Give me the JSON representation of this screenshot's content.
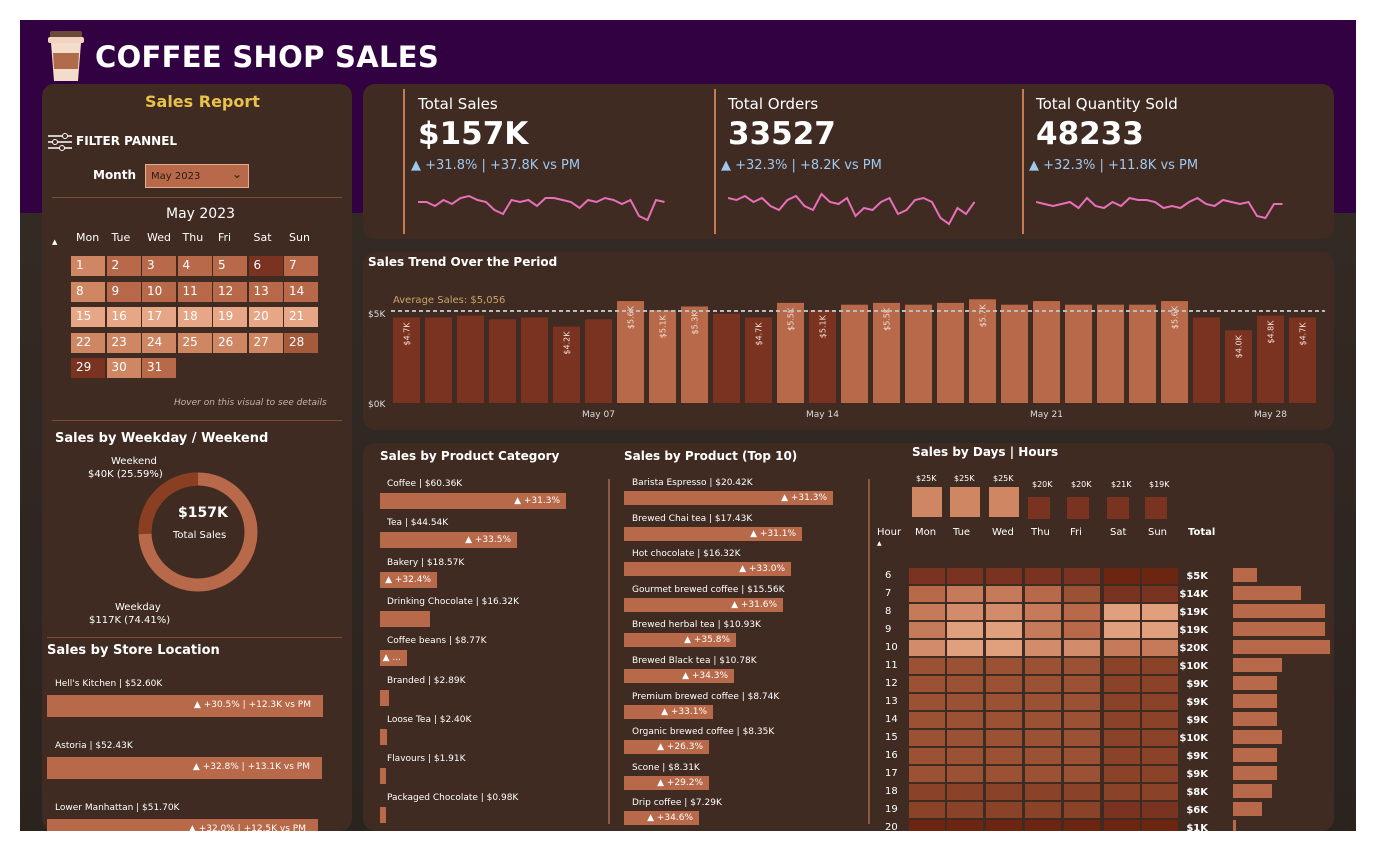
{
  "header": {
    "title": "COFFEE SHOP SALES"
  },
  "sidebar": {
    "title": "Sales Report",
    "filter_label": "FILTER PANNEL",
    "month_label": "Month",
    "month_value": "May 2023",
    "calendar": {
      "title": "May 2023",
      "weekdays": [
        "Mon",
        "Tue",
        "Wed",
        "Thu",
        "Fri",
        "Sat",
        "Sun"
      ],
      "days": [
        "1",
        "2",
        "3",
        "4",
        "5",
        "6",
        "7",
        "8",
        "9",
        "10",
        "11",
        "12",
        "13",
        "14",
        "15",
        "16",
        "17",
        "18",
        "19",
        "20",
        "21",
        "22",
        "23",
        "24",
        "25",
        "26",
        "27",
        "28",
        "29",
        "30",
        "31"
      ],
      "hint": "Hover on this visual to see details"
    },
    "weekday_section": {
      "title": "Sales by Weekday / Weekend",
      "weekend_label": "Weekend",
      "weekend_value": "$40K (25.59%)",
      "weekday_label": "Weekday",
      "weekday_value": "$117K (74.41%)",
      "center_value": "$157K",
      "center_label": "Total Sales",
      "weekend_share": 0.2559
    },
    "store_section": {
      "title": "Sales by Store Location",
      "stores": [
        {
          "label": "Hell's Kitchen | $52.60K",
          "change": "▲ +30.5% | +12.3K vs PM",
          "share": 1.0
        },
        {
          "label": "Astoria | $52.43K",
          "change": "▲ +32.8% | +13.1K vs PM",
          "share": 0.997
        },
        {
          "label": "Lower Manhattan | $51.70K",
          "change": "▲ +32.0% | +12.5K vs PM",
          "share": 0.983
        }
      ]
    }
  },
  "kpis": [
    {
      "title": "Total Sales",
      "value": "$157K",
      "change": "▲ +31.8% | +37.8K vs PM"
    },
    {
      "title": "Total Orders",
      "value": "33527",
      "change": "▲ +32.3% | +8.2K vs PM"
    },
    {
      "title": "Total Quantity Sold",
      "value": "48233",
      "change": "▲ +32.3% | +11.8K vs PM"
    }
  ],
  "trend": {
    "title": "Sales Trend Over the Period",
    "avg_label": "Average Sales: $5,056",
    "y_ticks": [
      "$5K",
      "$0K"
    ],
    "x_ticks": [
      "May 07",
      "May 14",
      "May 21",
      "May 28"
    ],
    "bar_labels": [
      "$4.7K",
      "$4.2K",
      "$5.6K",
      "$5.1K",
      "$5.3K",
      "$4.7K",
      "$5.5K",
      "$5.1K",
      "$5.5K",
      "$5.7K",
      "$5.6K",
      "$4.0K",
      "$4.8K",
      "$4.7K"
    ]
  },
  "chart_data": {
    "type": "bar",
    "title": "Sales Trend Over the Period",
    "x": [
      "May 1",
      "May 2",
      "May 3",
      "May 4",
      "May 5",
      "May 6",
      "May 7",
      "May 8",
      "May 9",
      "May 10",
      "May 11",
      "May 12",
      "May 13",
      "May 14",
      "May 15",
      "May 16",
      "May 17",
      "May 18",
      "May 19",
      "May 20",
      "May 21",
      "May 22",
      "May 23",
      "May 24",
      "May 25",
      "May 26",
      "May 27",
      "May 28",
      "May 29",
      "May 30",
      "May 31"
    ],
    "values": [
      4.7,
      4.7,
      4.8,
      4.6,
      4.7,
      4.2,
      4.6,
      5.6,
      5.1,
      5.3,
      4.9,
      4.7,
      5.5,
      5.1,
      5.4,
      5.5,
      5.4,
      5.5,
      5.7,
      5.4,
      5.6,
      5.4,
      5.4,
      5.4,
      5.6,
      4.7,
      4.0,
      4.8,
      4.7
    ],
    "average": 5.056,
    "ylim": [
      0,
      6
    ],
    "ylabel": ""
  },
  "category_section": {
    "title": "Sales by Product Category",
    "items": [
      {
        "label": "Coffee | $60.36K",
        "change": "▲ +31.3%",
        "share": 1.0
      },
      {
        "label": "Tea | $44.54K",
        "change": "▲ +33.5%",
        "share": 0.738
      },
      {
        "label": "Bakery | $18.57K",
        "change": "▲ +32.4%",
        "share": 0.308
      },
      {
        "label": "Drinking Chocolate | $16.32K",
        "change": "",
        "share": 0.27
      },
      {
        "label": "Coffee beans | $8.77K",
        "change": "▲ ...",
        "share": 0.145
      },
      {
        "label": "Branded | $2.89K",
        "change": "",
        "share": 0.048
      },
      {
        "label": "Loose Tea | $2.40K",
        "change": "",
        "share": 0.04
      },
      {
        "label": "Flavours | $1.91K",
        "change": "",
        "share": 0.032
      },
      {
        "label": "Packaged Chocolate | $0.98K",
        "change": "",
        "share": 0.016
      }
    ]
  },
  "product_section": {
    "title": "Sales by Product (Top 10)",
    "items": [
      {
        "label": "Barista Espresso | $20.42K",
        "change": "▲ +31.3%",
        "share": 1.0
      },
      {
        "label": "Brewed Chai tea | $17.43K",
        "change": "▲ +31.1%",
        "share": 0.854
      },
      {
        "label": "Hot chocolate | $16.32K",
        "change": "▲ +33.0%",
        "share": 0.799
      },
      {
        "label": "Gourmet brewed coffee | $15.56K",
        "change": "▲ +31.6%",
        "share": 0.762
      },
      {
        "label": "Brewed herbal tea | $10.93K",
        "change": "▲ +35.8%",
        "share": 0.535
      },
      {
        "label": "Brewed Black tea | $10.78K",
        "change": "▲ +34.3%",
        "share": 0.528
      },
      {
        "label": "Premium brewed coffee | $8.74K",
        "change": "▲ +33.1%",
        "share": 0.428
      },
      {
        "label": "Organic brewed coffee | $8.35K",
        "change": "▲ +26.3%",
        "share": 0.409
      },
      {
        "label": "Scone | $8.31K",
        "change": "▲ +29.2%",
        "share": 0.407
      },
      {
        "label": "Drip coffee | $7.29K",
        "change": "▲ +34.6%",
        "share": 0.357
      }
    ]
  },
  "heatmap_section": {
    "title": "Sales by Days | Hours",
    "day_totals": [
      "$25K",
      "$25K",
      "$25K",
      "$20K",
      "$20K",
      "$21K",
      "$19K"
    ],
    "day_labels": [
      "Mon",
      "Tue",
      "Wed",
      "Thu",
      "Fri",
      "Sat",
      "Sun"
    ],
    "hour_header": "Hour",
    "total_header": "Total",
    "hours": [
      "6",
      "7",
      "8",
      "9",
      "10",
      "11",
      "12",
      "13",
      "14",
      "15",
      "16",
      "17",
      "18",
      "19",
      "20"
    ],
    "hour_totals": [
      "$5K",
      "$14K",
      "$19K",
      "$19K",
      "$20K",
      "$10K",
      "$9K",
      "$9K",
      "$9K",
      "$10K",
      "$9K",
      "$9K",
      "$8K",
      "$6K",
      "$1K"
    ],
    "hour_share": [
      0.25,
      0.7,
      0.95,
      0.95,
      1.0,
      0.5,
      0.45,
      0.45,
      0.45,
      0.5,
      0.45,
      0.45,
      0.4,
      0.3,
      0.03
    ]
  },
  "colors": {
    "background": "#2a221d",
    "header_band": "#320142",
    "panel": "#3f2b22",
    "accent_bar": "#b8694a",
    "title_yellow": "#e8c24a",
    "kpi_change": "#9fc8ef",
    "sparkline": "#e86fb8"
  }
}
